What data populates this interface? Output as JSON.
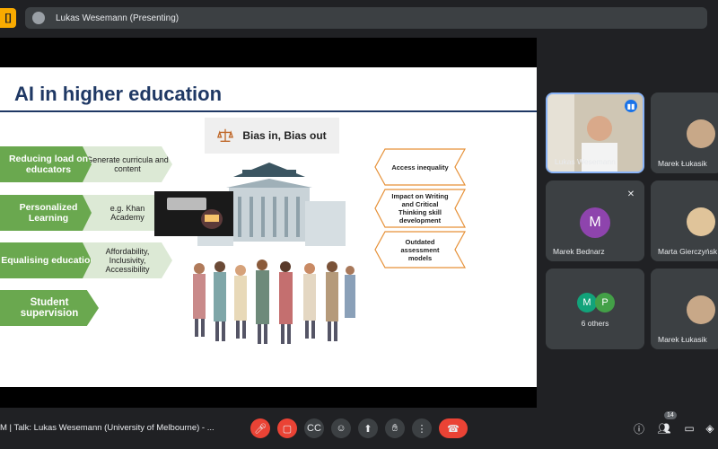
{
  "app": {
    "logo_text": "[]"
  },
  "presenter_bar": {
    "label": "Lukas Wesemann (Presenting)"
  },
  "slide": {
    "title": "AI in higher education",
    "center_box": "Bias in, Bias out",
    "green_items": [
      {
        "main": "Reducing load on educators",
        "detail": "Generate curricula and content"
      },
      {
        "main": "Personalized Learning",
        "detail": "e.g. Khan Academy"
      },
      {
        "main": "Equalising education",
        "detail": "Affordability, Inclusivity, Accessibility"
      },
      {
        "main": "Student supervision",
        "detail": ""
      }
    ],
    "orange_items": [
      "Access inequality",
      "Impact on Writing and Critical Thinking skill development",
      "Outdated assessment models"
    ]
  },
  "participants": [
    {
      "name": "Lukas Wesemann",
      "type": "video",
      "speaking": true
    },
    {
      "name": "Marek Łukasik",
      "type": "video"
    },
    {
      "name": "Marek Bednarz",
      "type": "initial",
      "initial": "M",
      "color": "#8e44ad",
      "muted": true
    },
    {
      "name": "Marta Gierczyńsk",
      "type": "video"
    },
    {
      "name": "6 others",
      "type": "group",
      "initials": [
        "M",
        "P"
      ],
      "colors": [
        "#12a37a",
        "#43a047"
      ]
    },
    {
      "name": "Marek Łukasik",
      "type": "video"
    }
  ],
  "bottom_bar": {
    "meeting_title": "M  |  Talk: Lukas Wesemann (University of Melbourne) - ...",
    "participant_count": "14",
    "icons": [
      "mic-off-icon",
      "camera-off-icon",
      "captions-icon",
      "emoji-icon",
      "present-icon",
      "raise-hand-icon",
      "more-options-icon",
      "end-call-icon"
    ]
  }
}
